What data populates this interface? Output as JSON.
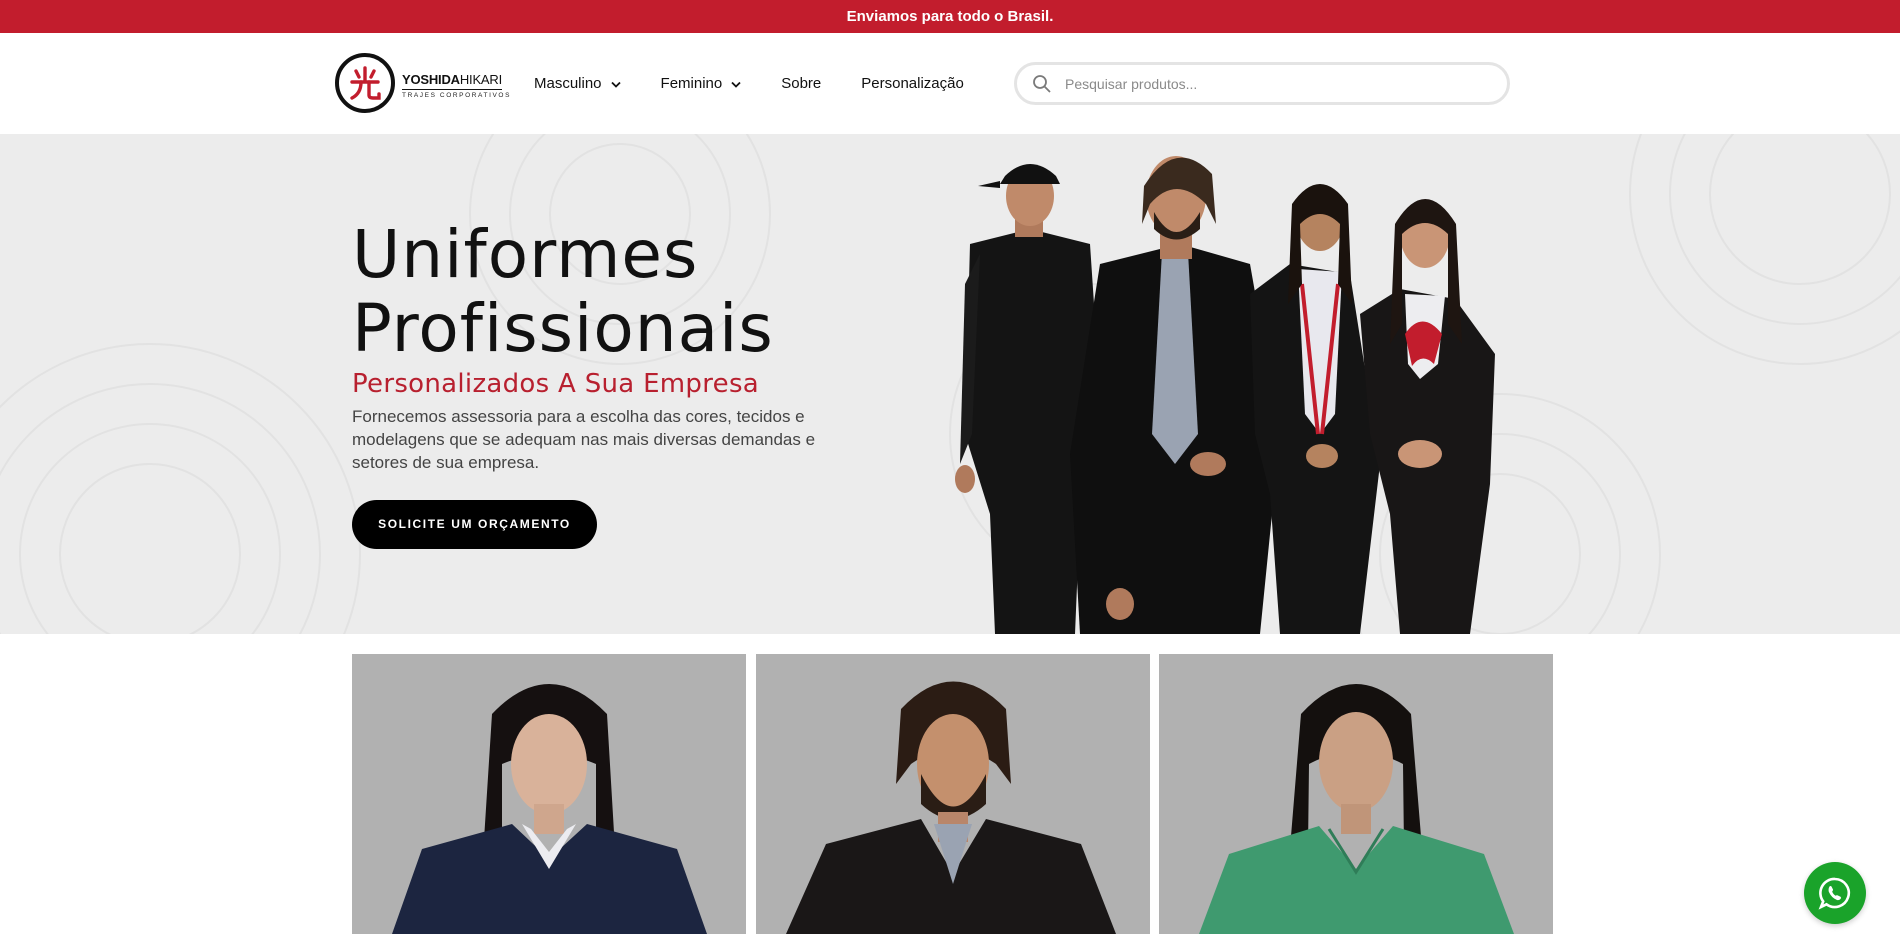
{
  "topbar": {
    "text": "Enviamos para todo o Brasil."
  },
  "header": {
    "logo": {
      "brand_bold": "YOSHIDA",
      "brand_light": "HIKARI",
      "tagline": "TRAJES CORPORATIVOS",
      "kanji": "光",
      "icon": "logo-icon"
    },
    "nav": [
      {
        "label": "Masculino",
        "has_dropdown": true
      },
      {
        "label": "Feminino",
        "has_dropdown": true
      },
      {
        "label": "Sobre",
        "has_dropdown": false
      },
      {
        "label": "Personalização",
        "has_dropdown": false
      }
    ],
    "search": {
      "placeholder": "Pesquisar produtos...",
      "value": "",
      "icon": "search-icon"
    }
  },
  "hero": {
    "title_line1": "Uniformes",
    "title_line2": "Profissionais",
    "subtitle": "Personalizados A Sua Empresa",
    "description": "Fornecemos assessoria para a escolha das cores, tecidos e modelagens que se adequam nas mais diversas demandas e setores de sua empresa.",
    "cta_label": "SOLICITE UM ORÇAMENTO"
  },
  "cards": [
    {
      "subject": "woman in navy cardigan",
      "garment_color": "#1c2540"
    },
    {
      "subject": "man in black coat",
      "garment_color": "#1a1717"
    },
    {
      "subject": "woman in green scrubs",
      "garment_color": "#3f9a6f"
    }
  ],
  "colors": {
    "accent": "#c21d2d",
    "whatsapp": "#1aa32a",
    "card_bg": "#b1b1b1"
  },
  "whatsapp": {
    "icon": "whatsapp-icon"
  }
}
